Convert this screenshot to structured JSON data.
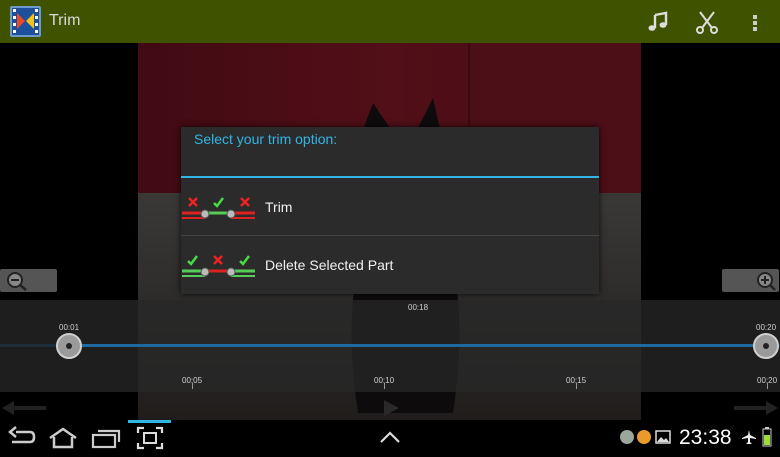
{
  "app": {
    "title": "Trim",
    "icon": "film-scissors-icon"
  },
  "actionbar": {
    "actions": [
      {
        "icon": "music-note-icon"
      },
      {
        "icon": "scissors-icon"
      },
      {
        "icon": "overflow-menu-icon"
      }
    ]
  },
  "timeline": {
    "current_time": "00:18",
    "start_label": "00:01",
    "end_label": "00:20",
    "ticks": [
      "00:05",
      "00:10",
      "00:15",
      "00:20"
    ]
  },
  "dialog": {
    "title": "Select your trim option:",
    "options": [
      {
        "label": "Trim",
        "icon": "trim-keep-middle-icon"
      },
      {
        "label": "Delete Selected Part",
        "icon": "delete-middle-icon"
      }
    ]
  },
  "statusbar": {
    "time": "23:38",
    "icons": [
      "w-icon",
      "notification-icon",
      "gallery-icon",
      "airplane-icon",
      "battery-icon"
    ]
  },
  "colors": {
    "actionbar": "#3f5200",
    "accent": "#33b5e5",
    "dialog_bg": "#2b2b2b"
  }
}
